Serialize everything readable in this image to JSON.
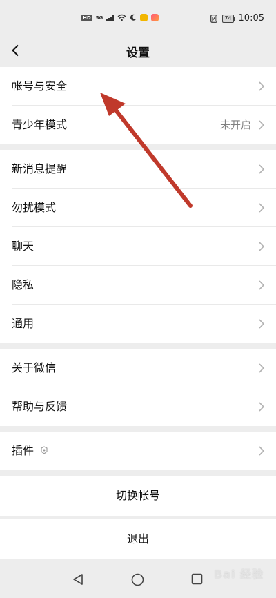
{
  "status_bar": {
    "hd_badge": "HD",
    "network": "5G",
    "time": "10:05",
    "battery": "74"
  },
  "header": {
    "title": "设置"
  },
  "groups": [
    [
      {
        "label": "帐号与安全",
        "value": ""
      },
      {
        "label": "青少年模式",
        "value": "未开启"
      }
    ],
    [
      {
        "label": "新消息提醒",
        "value": ""
      },
      {
        "label": "勿扰模式",
        "value": ""
      },
      {
        "label": "聊天",
        "value": ""
      },
      {
        "label": "隐私",
        "value": ""
      },
      {
        "label": "通用",
        "value": ""
      }
    ],
    [
      {
        "label": "关于微信",
        "value": ""
      },
      {
        "label": "帮助与反馈",
        "value": ""
      }
    ],
    [
      {
        "label": "插件",
        "value": ""
      }
    ]
  ],
  "actions": {
    "switch_account": "切换帐号",
    "logout": "退出"
  },
  "annotation": {
    "arrow_color": "#c0392b",
    "target": "帐号与安全"
  },
  "watermark": "Bai 经验"
}
